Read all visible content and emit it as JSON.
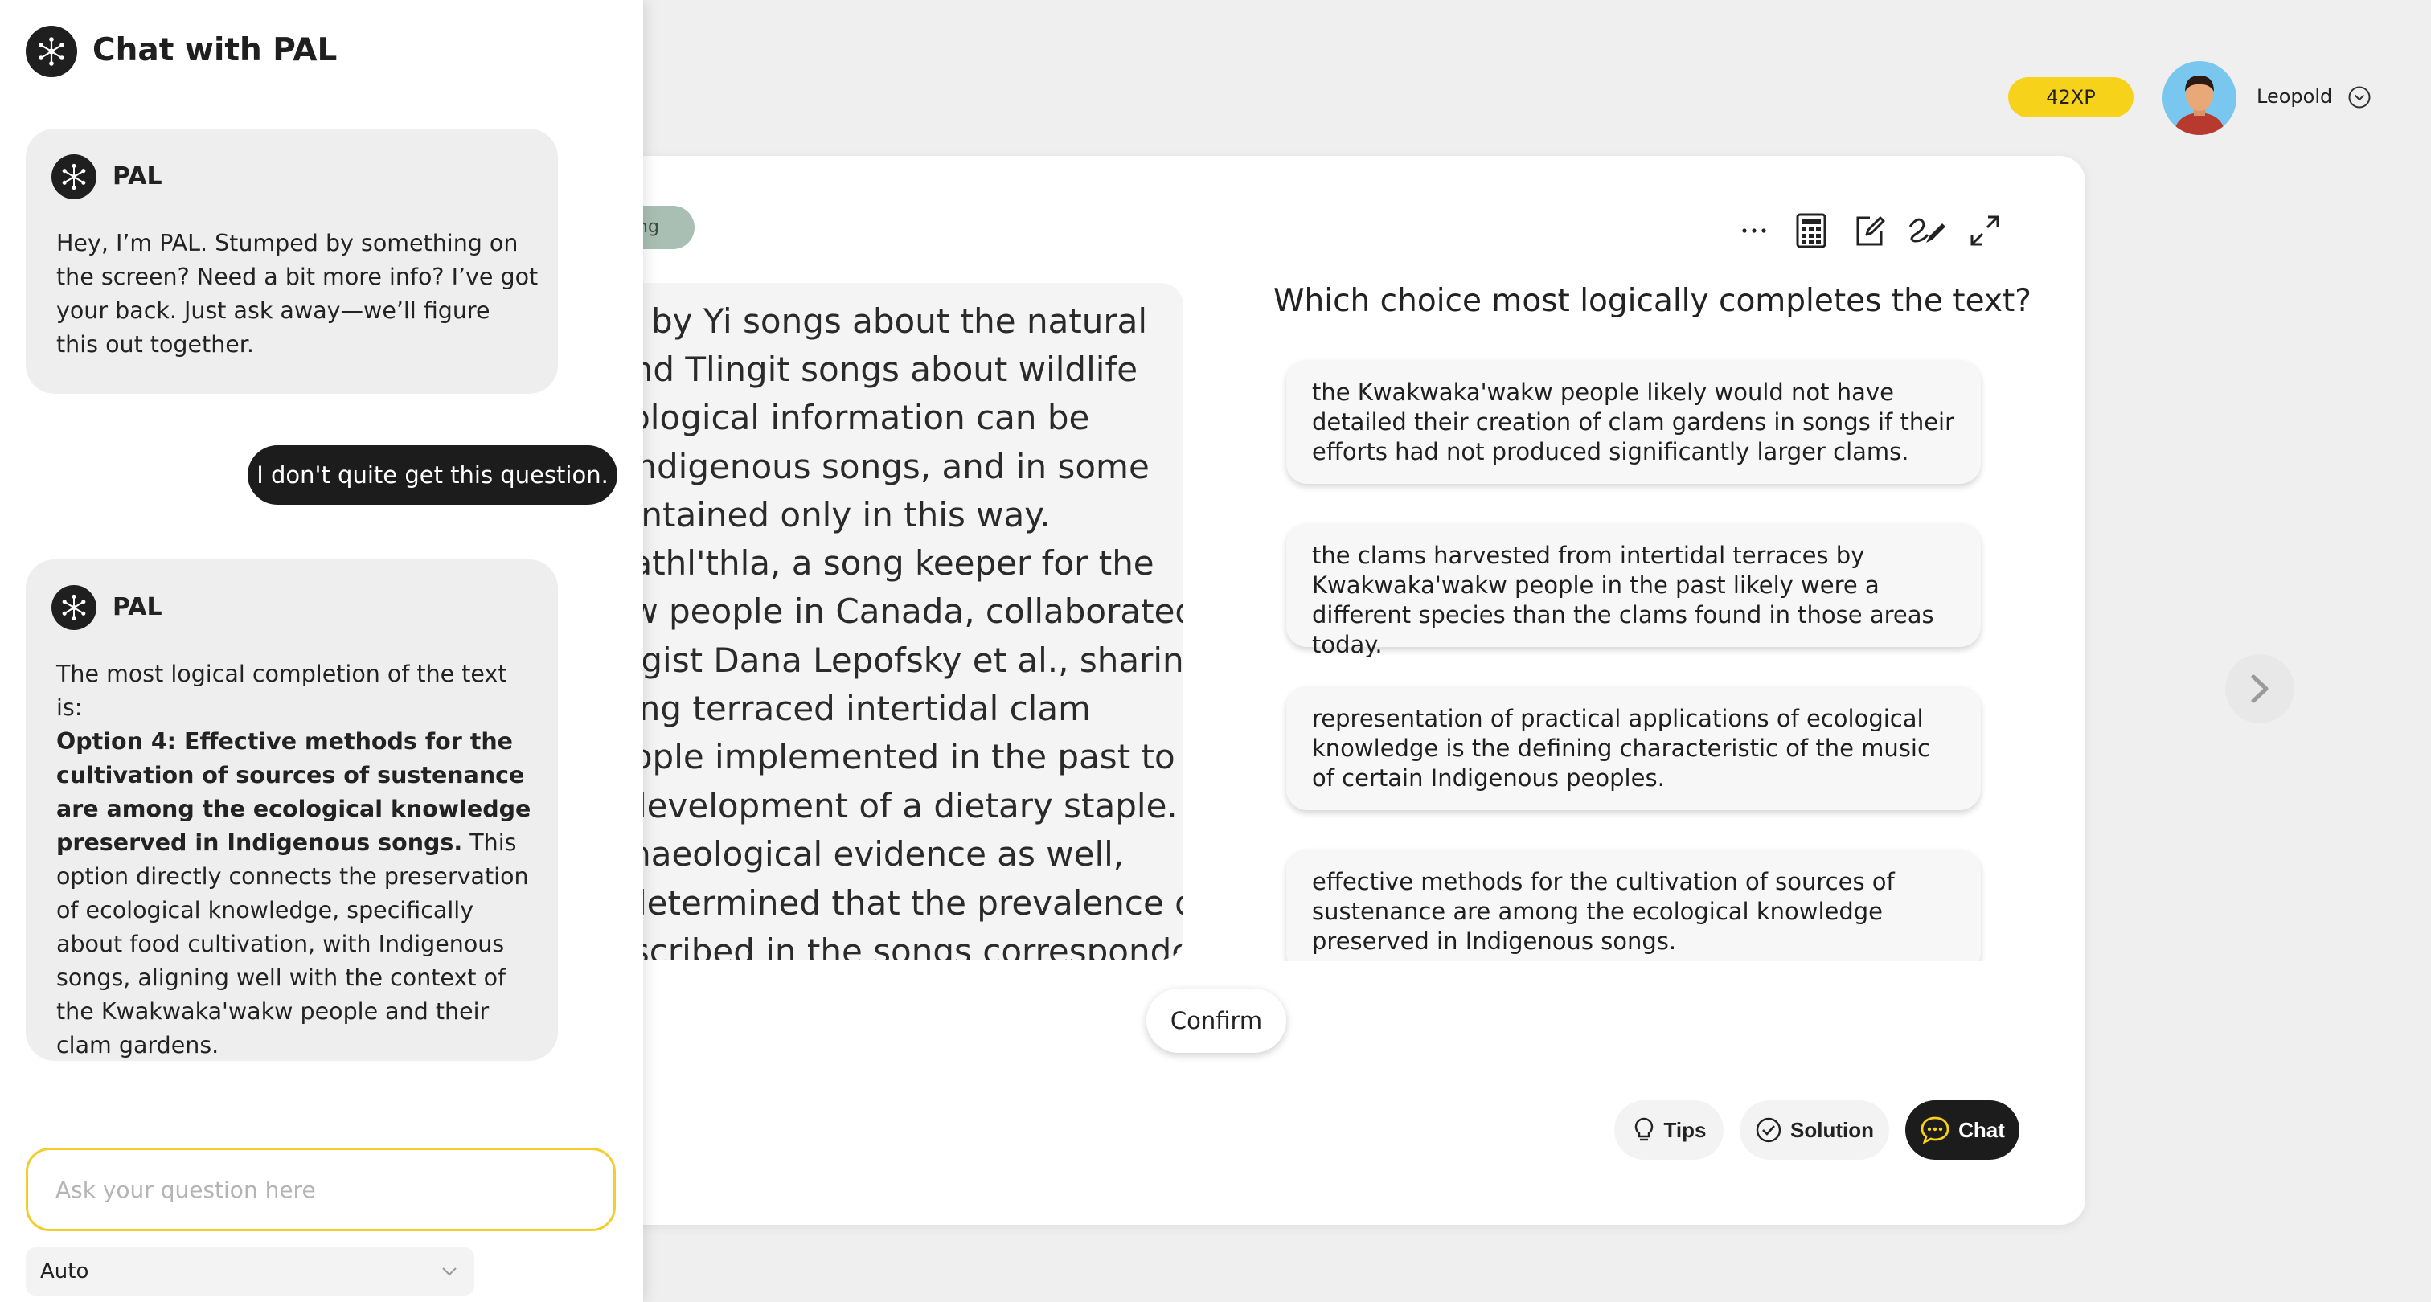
{
  "header": {
    "xp": "42XP",
    "user_name": "Leopold"
  },
  "chip": {
    "label": "ng"
  },
  "passage": {
    "lines": [
      "d by Yi songs about the natural",
      "and Tlingit songs about wildlife",
      "cological information can be",
      " Indigenous songs, and in some",
      "aintained only in this way.",
      "Vathl'thla, a song keeper for the",
      "kw people in Canada, collaborated",
      "logist Dana Lepofsky et al., sharing",
      "cing terraced intertidal clam",
      "eople implemented in the past to",
      " development of a dietary staple.",
      "chaeological evidence as well,",
      " determined that the prevalence of",
      "escribed in the songs corresponded"
    ]
  },
  "question": {
    "prompt": "Which choice most logically completes the text?",
    "options": [
      "the Kwakwaka'wakw people likely would not have detailed their creation of clam gardens in songs if their efforts had not produced significantly larger clams.",
      "the clams harvested from intertidal terraces by Kwakwaka'wakw people in the past likely were a different species than the clams found in those areas today.",
      "representation of practical applications of ecological knowledge is the defining characteristic of the music of certain Indigenous peoples.",
      "effective methods for the cultivation of sources of sustenance are among the ecological knowledge preserved in Indigenous songs."
    ],
    "confirm_label": "Confirm"
  },
  "tools": [
    "more-icon",
    "calculator-icon",
    "edit-icon",
    "draw-icon",
    "expand-icon"
  ],
  "actions": {
    "tips": "Tips",
    "solution": "Solution",
    "chat": "Chat"
  },
  "chat": {
    "title": "Chat with PAL",
    "messages": [
      {
        "sender": "PAL",
        "text": "Hey, I’m PAL. Stumped by something on the screen? Need a bit more info? I’ve got your back. Just ask away—we’ll figure this out together."
      },
      {
        "sender": "user",
        "text": "I don't quite get this question."
      },
      {
        "sender": "PAL",
        "intro": "The most logical completion of the text is:",
        "bold": "Option 4: Effective methods for the cultivation of sources of sustenance are among the ecological knowledge preserved in Indigenous songs.",
        "rest": " This option directly connects the preservation of ecological knowledge, specifically about food cultivation, with Indigenous songs, aligning well with the context of the Kwakwaka'wakw people and their clam gardens."
      }
    ],
    "input_placeholder": "Ask your question here",
    "mode": "Auto"
  },
  "colors": {
    "accent_yellow": "#f7d21a",
    "input_border": "#f3cd2b",
    "dark": "#1c1c1c",
    "avatar_bg": "#79c7ee"
  }
}
